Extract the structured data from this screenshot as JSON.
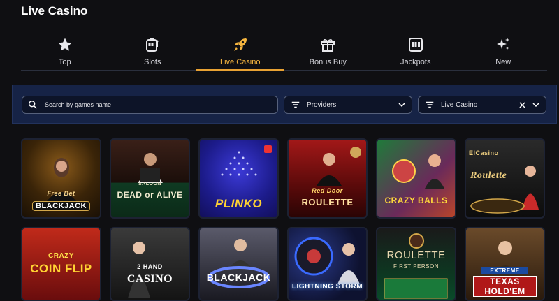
{
  "page_title": "Live Casino",
  "tabs": [
    {
      "label": "Top",
      "icon": "star-icon",
      "active": false
    },
    {
      "label": "Slots",
      "icon": "slot-machine-icon",
      "active": false
    },
    {
      "label": "Live Casino",
      "icon": "rocket-icon",
      "active": true
    },
    {
      "label": "Bonus Buy",
      "icon": "gift-icon",
      "active": false
    },
    {
      "label": "Jackpots",
      "icon": "jackpot-icon",
      "active": false
    },
    {
      "label": "New",
      "icon": "sparkles-icon",
      "active": false
    }
  ],
  "filters": {
    "search_placeholder": "Search by games name",
    "providers_label": "Providers",
    "category_label": "Live Casino"
  },
  "games": [
    {
      "label": "BLACKJACK",
      "sub": "Free Bet"
    },
    {
      "label": "DEAD or ALIVE",
      "sub": "SALOON"
    },
    {
      "label": "PLINKO",
      "sub": ""
    },
    {
      "label": "ROULETTE",
      "sub": "Red Door"
    },
    {
      "label": "CRAZY BALLS",
      "sub": ""
    },
    {
      "label": "Roulette",
      "sub": "ElCasino"
    },
    {
      "label": "COIN FLIP",
      "sub": "CRAZY"
    },
    {
      "label": "CASINO",
      "sub": "2 HAND"
    },
    {
      "label": "BLACKJACK",
      "sub": ""
    },
    {
      "label": "LIGHTNING STORM",
      "sub": ""
    },
    {
      "label": "ROULETTE",
      "sub": "FIRST PERSON"
    },
    {
      "label": "TEXAS HOLD'EM",
      "sub": "EXTREME"
    }
  ],
  "colors": {
    "accent": "#f5b53f",
    "bg": "#0f0f12",
    "filterbar": "#162346"
  }
}
